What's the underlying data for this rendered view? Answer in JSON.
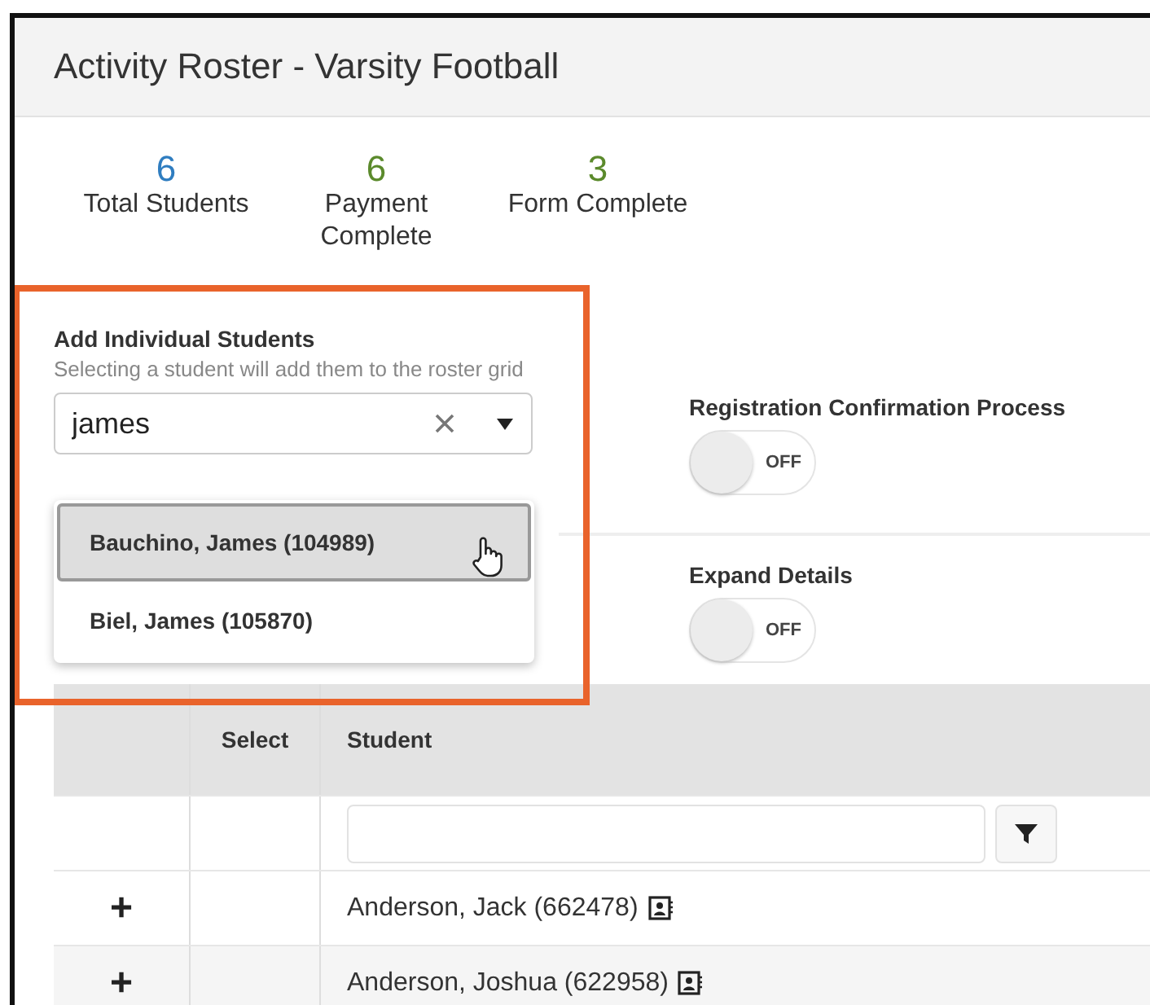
{
  "window": {
    "title": "Activity Roster - Varsity Football"
  },
  "stats": [
    {
      "value": "6",
      "label": "Total Students",
      "color": "#2f7dc0"
    },
    {
      "value": "6",
      "label": "Payment Complete",
      "color": "#5b8a2c"
    },
    {
      "value": "3",
      "label": "Form Complete",
      "color": "#5b8a2c"
    }
  ],
  "add_students": {
    "label": "Add Individual Students",
    "hint": "Selecting a student will add them to the roster grid",
    "search": {
      "value": "james"
    },
    "options": [
      {
        "label": "Bauchino, James (104989)",
        "selected": true
      },
      {
        "label": "Biel, James (105870)",
        "selected": false
      }
    ]
  },
  "toggles": [
    {
      "label": "Registration Confirmation Process",
      "on": false,
      "state_text": "OFF"
    },
    {
      "label": "Expand Details",
      "on": false,
      "state_text": "OFF"
    }
  ],
  "table": {
    "columns": [
      "Select",
      "Student"
    ],
    "rows": [
      {
        "expander": "+",
        "student": "Anderson, Jack (662478)"
      },
      {
        "expander": "+",
        "student": "Anderson, Joshua (622958)"
      }
    ]
  }
}
